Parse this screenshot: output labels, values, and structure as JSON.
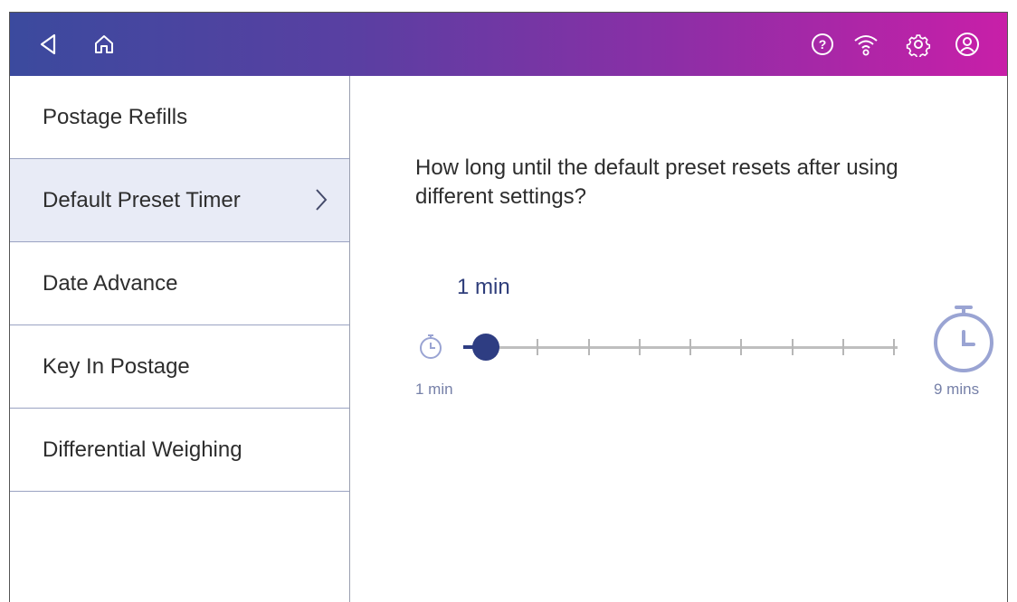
{
  "topbar": {
    "icons": [
      "back-icon",
      "home-icon",
      "help-icon",
      "wifi-icon",
      "settings-icon",
      "profile-icon"
    ],
    "gradient": [
      "#3b4a9e",
      "#c81fa8"
    ]
  },
  "sidebar": {
    "items": [
      {
        "label": "Postage Refills",
        "active": false
      },
      {
        "label": "Default Preset Timer",
        "active": true
      },
      {
        "label": "Date Advance",
        "active": false
      },
      {
        "label": "Key In Postage",
        "active": false
      },
      {
        "label": "Differential Weighing",
        "active": false
      }
    ]
  },
  "main": {
    "question": "How long until the default preset resets after using different settings?",
    "current_value": "1 min",
    "slider": {
      "value": 1,
      "min": 1,
      "max": 9,
      "min_label": "1 min",
      "max_label": "9 mins",
      "accent": "#2e3d82"
    }
  }
}
